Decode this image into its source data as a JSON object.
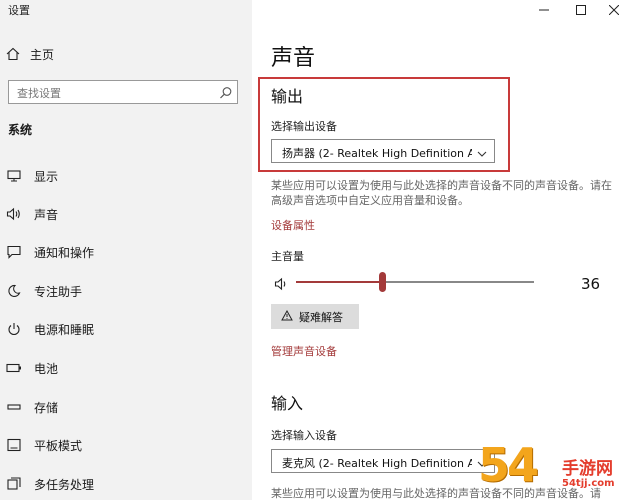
{
  "window": {
    "title": "设置",
    "controls": {
      "minimize": "minimize-icon",
      "maximize": "maximize-icon",
      "close": "close-icon"
    }
  },
  "sidebar": {
    "home_label": "主页",
    "search_placeholder": "查找设置",
    "section_title": "系统",
    "items": [
      {
        "label": "显示",
        "icon": "monitor-icon"
      },
      {
        "label": "声音",
        "icon": "speaker-icon"
      },
      {
        "label": "通知和操作",
        "icon": "notification-icon"
      },
      {
        "label": "专注助手",
        "icon": "moon-icon"
      },
      {
        "label": "电源和睡眠",
        "icon": "power-icon"
      },
      {
        "label": "电池",
        "icon": "battery-icon"
      },
      {
        "label": "存储",
        "icon": "storage-icon"
      },
      {
        "label": "平板模式",
        "icon": "tablet-icon"
      },
      {
        "label": "多任务处理",
        "icon": "multitask-icon"
      }
    ]
  },
  "main": {
    "page_title": "声音",
    "output": {
      "heading": "输出",
      "device_label": "选择输出设备",
      "device_value": "扬声器 (2- Realtek High Definition A...",
      "description": "某些应用可以设置为使用与此处选择的声音设备不同的声音设备。请在高级声音选项中自定义应用音量和设备。",
      "properties_link": "设备属性",
      "volume_label": "主音量",
      "volume_value": "36",
      "volume_fraction": 0.36,
      "troubleshoot_label": "疑难解答",
      "manage_link": "管理声音设备"
    },
    "input": {
      "heading": "输入",
      "device_label": "选择输入设备",
      "device_value": "麦克风 (2- Realtek High Definition A...",
      "description": "某些应用可以设置为使用与此处选择的声音设备不同的声音设备。请"
    }
  },
  "watermark": {
    "number": "54",
    "brand": "手游网",
    "url": "54tjj.com"
  },
  "colors": {
    "accent": "#a33a3a",
    "highlight_border": "#c83a3a",
    "sidebar_bg": "#f2f2f2"
  }
}
